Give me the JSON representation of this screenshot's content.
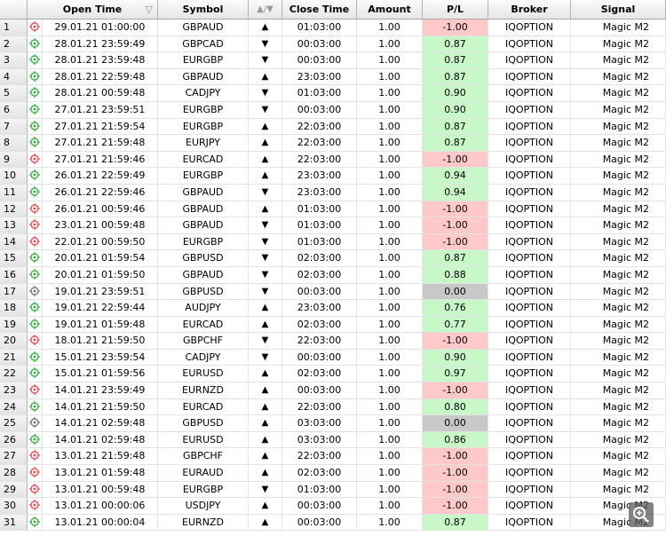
{
  "columns": {
    "open_time": "Open Time",
    "symbol": "Symbol",
    "dir": "▲/▼",
    "close_time": "Close Time",
    "amount": "Amount",
    "pl": "P/L",
    "broker": "Broker",
    "signal": "Signal"
  },
  "sort_indicator": "▽",
  "colors": {
    "win": "#c8f7c8",
    "loss": "#ffc9c9",
    "draw": "#c8c8c8"
  },
  "rows": [
    {
      "n": "1",
      "status": "loss",
      "open": "29.01.21 01:00:00",
      "symbol": "GBPAUD",
      "dir": "▲",
      "close": "01:03:00",
      "amount": "1.00",
      "pl": "-1.00",
      "broker": "IQOPTION",
      "signal": "Magic M2"
    },
    {
      "n": "2",
      "status": "win",
      "open": "28.01.21 23:59:49",
      "symbol": "GBPCAD",
      "dir": "▼",
      "close": "00:03:00",
      "amount": "1.00",
      "pl": "0.87",
      "broker": "IQOPTION",
      "signal": "Magic M2"
    },
    {
      "n": "3",
      "status": "win",
      "open": "28.01.21 23:59:48",
      "symbol": "EURGBP",
      "dir": "▼",
      "close": "00:03:00",
      "amount": "1.00",
      "pl": "0.87",
      "broker": "IQOPTION",
      "signal": "Magic M2"
    },
    {
      "n": "4",
      "status": "win",
      "open": "28.01.21 22:59:48",
      "symbol": "GBPAUD",
      "dir": "▲",
      "close": "23:03:00",
      "amount": "1.00",
      "pl": "0.87",
      "broker": "IQOPTION",
      "signal": "Magic M2"
    },
    {
      "n": "5",
      "status": "win",
      "open": "28.01.21 00:59:48",
      "symbol": "CADJPY",
      "dir": "▼",
      "close": "01:03:00",
      "amount": "1.00",
      "pl": "0.90",
      "broker": "IQOPTION",
      "signal": "Magic M2"
    },
    {
      "n": "6",
      "status": "win",
      "open": "27.01.21 23:59:51",
      "symbol": "EURGBP",
      "dir": "▼",
      "close": "00:03:00",
      "amount": "1.00",
      "pl": "0.90",
      "broker": "IQOPTION",
      "signal": "Magic M2"
    },
    {
      "n": "7",
      "status": "win",
      "open": "27.01.21 21:59:54",
      "symbol": "EURGBP",
      "dir": "▲",
      "close": "22:03:00",
      "amount": "1.00",
      "pl": "0.87",
      "broker": "IQOPTION",
      "signal": "Magic M2"
    },
    {
      "n": "8",
      "status": "win",
      "open": "27.01.21 21:59:48",
      "symbol": "EURJPY",
      "dir": "▲",
      "close": "22:03:00",
      "amount": "1.00",
      "pl": "0.87",
      "broker": "IQOPTION",
      "signal": "Magic M2"
    },
    {
      "n": "9",
      "status": "loss",
      "open": "27.01.21 21:59:46",
      "symbol": "EURCAD",
      "dir": "▲",
      "close": "22:03:00",
      "amount": "1.00",
      "pl": "-1.00",
      "broker": "IQOPTION",
      "signal": "Magic M2"
    },
    {
      "n": "10",
      "status": "win",
      "open": "26.01.21 22:59:49",
      "symbol": "EURGBP",
      "dir": "▲",
      "close": "23:03:00",
      "amount": "1.00",
      "pl": "0.94",
      "broker": "IQOPTION",
      "signal": "Magic M2"
    },
    {
      "n": "11",
      "status": "win",
      "open": "26.01.21 22:59:46",
      "symbol": "GBPAUD",
      "dir": "▼",
      "close": "23:03:00",
      "amount": "1.00",
      "pl": "0.94",
      "broker": "IQOPTION",
      "signal": "Magic M2"
    },
    {
      "n": "12",
      "status": "loss",
      "open": "26.01.21 00:59:46",
      "symbol": "GBPAUD",
      "dir": "▲",
      "close": "01:03:00",
      "amount": "1.00",
      "pl": "-1.00",
      "broker": "IQOPTION",
      "signal": "Magic M2"
    },
    {
      "n": "13",
      "status": "loss",
      "open": "23.01.21 00:59:48",
      "symbol": "GBPAUD",
      "dir": "▼",
      "close": "01:03:00",
      "amount": "1.00",
      "pl": "-1.00",
      "broker": "IQOPTION",
      "signal": "Magic M2"
    },
    {
      "n": "14",
      "status": "loss",
      "open": "22.01.21 00:59:50",
      "symbol": "EURGBP",
      "dir": "▼",
      "close": "01:03:00",
      "amount": "1.00",
      "pl": "-1.00",
      "broker": "IQOPTION",
      "signal": "Magic M2"
    },
    {
      "n": "15",
      "status": "win",
      "open": "20.01.21 01:59:54",
      "symbol": "GBPUSD",
      "dir": "▼",
      "close": "02:03:00",
      "amount": "1.00",
      "pl": "0.87",
      "broker": "IQOPTION",
      "signal": "Magic M2"
    },
    {
      "n": "16",
      "status": "win",
      "open": "20.01.21 01:59:50",
      "symbol": "GBPAUD",
      "dir": "▼",
      "close": "02:03:00",
      "amount": "1.00",
      "pl": "0.88",
      "broker": "IQOPTION",
      "signal": "Magic M2"
    },
    {
      "n": "17",
      "status": "draw",
      "open": "19.01.21 23:59:51",
      "symbol": "GBPUSD",
      "dir": "▼",
      "close": "00:03:00",
      "amount": "1.00",
      "pl": "0.00",
      "broker": "IQOPTION",
      "signal": "Magic M2"
    },
    {
      "n": "18",
      "status": "win",
      "open": "19.01.21 22:59:44",
      "symbol": "AUDJPY",
      "dir": "▲",
      "close": "23:03:00",
      "amount": "1.00",
      "pl": "0.76",
      "broker": "IQOPTION",
      "signal": "Magic M2"
    },
    {
      "n": "19",
      "status": "win",
      "open": "19.01.21 01:59:48",
      "symbol": "EURCAD",
      "dir": "▲",
      "close": "02:03:00",
      "amount": "1.00",
      "pl": "0.77",
      "broker": "IQOPTION",
      "signal": "Magic M2"
    },
    {
      "n": "20",
      "status": "loss",
      "open": "18.01.21 21:59:50",
      "symbol": "GBPCHF",
      "dir": "▼",
      "close": "22:03:00",
      "amount": "1.00",
      "pl": "-1.00",
      "broker": "IQOPTION",
      "signal": "Magic M2"
    },
    {
      "n": "21",
      "status": "win",
      "open": "15.01.21 23:59:54",
      "symbol": "CADJPY",
      "dir": "▼",
      "close": "00:03:00",
      "amount": "1.00",
      "pl": "0.90",
      "broker": "IQOPTION",
      "signal": "Magic M2"
    },
    {
      "n": "22",
      "status": "win",
      "open": "15.01.21 01:59:56",
      "symbol": "EURUSD",
      "dir": "▲",
      "close": "02:03:00",
      "amount": "1.00",
      "pl": "0.97",
      "broker": "IQOPTION",
      "signal": "Magic M2"
    },
    {
      "n": "23",
      "status": "loss",
      "open": "14.01.21 23:59:49",
      "symbol": "EURNZD",
      "dir": "▲",
      "close": "00:03:00",
      "amount": "1.00",
      "pl": "-1.00",
      "broker": "IQOPTION",
      "signal": "Magic M2"
    },
    {
      "n": "24",
      "status": "win",
      "open": "14.01.21 21:59:50",
      "symbol": "EURCAD",
      "dir": "▲",
      "close": "22:03:00",
      "amount": "1.00",
      "pl": "0.80",
      "broker": "IQOPTION",
      "signal": "Magic M2"
    },
    {
      "n": "25",
      "status": "draw",
      "open": "14.01.21 02:59:48",
      "symbol": "GBPUSD",
      "dir": "▲",
      "close": "03:03:00",
      "amount": "1.00",
      "pl": "0.00",
      "broker": "IQOPTION",
      "signal": "Magic M2"
    },
    {
      "n": "26",
      "status": "win",
      "open": "14.01.21 02:59:48",
      "symbol": "EURUSD",
      "dir": "▲",
      "close": "03:03:00",
      "amount": "1.00",
      "pl": "0.86",
      "broker": "IQOPTION",
      "signal": "Magic M2"
    },
    {
      "n": "27",
      "status": "loss",
      "open": "13.01.21 21:59:48",
      "symbol": "GBPCHF",
      "dir": "▲",
      "close": "22:03:00",
      "amount": "1.00",
      "pl": "-1.00",
      "broker": "IQOPTION",
      "signal": "Magic M2"
    },
    {
      "n": "28",
      "status": "loss",
      "open": "13.01.21 01:59:48",
      "symbol": "EURAUD",
      "dir": "▲",
      "close": "02:03:00",
      "amount": "1.00",
      "pl": "-1.00",
      "broker": "IQOPTION",
      "signal": "Magic M2"
    },
    {
      "n": "29",
      "status": "loss",
      "open": "13.01.21 00:59:48",
      "symbol": "EURGBP",
      "dir": "▼",
      "close": "01:03:00",
      "amount": "1.00",
      "pl": "-1.00",
      "broker": "IQOPTION",
      "signal": "Magic M2"
    },
    {
      "n": "30",
      "status": "loss",
      "open": "13.01.21 00:00:06",
      "symbol": "USDJPY",
      "dir": "▲",
      "close": "00:03:00",
      "amount": "1.00",
      "pl": "-1.00",
      "broker": "IQOPTION",
      "signal": "Magic M2"
    },
    {
      "n": "31",
      "status": "win",
      "open": "13.01.21 00:00:04",
      "symbol": "EURNZD",
      "dir": "▲",
      "close": "00:03:00",
      "amount": "1.00",
      "pl": "0.87",
      "broker": "IQOPTION",
      "signal": "Magic M2"
    }
  ]
}
